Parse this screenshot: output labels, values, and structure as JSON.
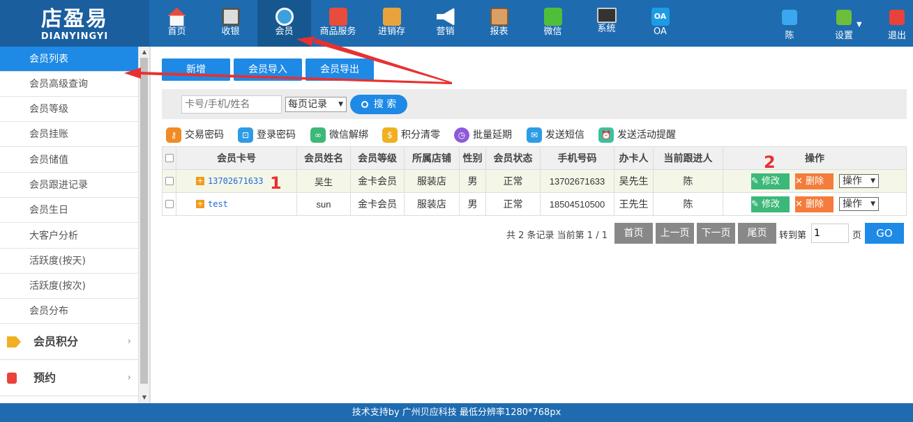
{
  "logo": {
    "big": "店盈易",
    "small": "DIANYINGYI"
  },
  "nav": [
    {
      "label": "首页",
      "icon": "home-icon"
    },
    {
      "label": "收银",
      "icon": "cash-register-icon"
    },
    {
      "label": "会员",
      "icon": "member-icon"
    },
    {
      "label": "商品服务",
      "icon": "product-icon"
    },
    {
      "label": "进销存",
      "icon": "inventory-icon"
    },
    {
      "label": "营销",
      "icon": "marketing-icon"
    },
    {
      "label": "报表",
      "icon": "report-icon"
    },
    {
      "label": "微信",
      "icon": "wechat-icon"
    },
    {
      "label": "系统",
      "icon": "system-icon"
    },
    {
      "label": "OA",
      "icon": "oa-icon"
    }
  ],
  "nav_right": {
    "user": "陈",
    "settings": "设置",
    "logout": "退出",
    "oa_badge": "OA"
  },
  "sidebar": {
    "items": [
      "会员列表",
      "会员高级查询",
      "会员等级",
      "会员挂账",
      "会员储值",
      "会员跟进记录",
      "会员生日",
      "大客户分析",
      "活跃度(按天)",
      "活跃度(按次)",
      "会员分布"
    ],
    "groups": [
      {
        "label": "会员积分",
        "icon": "tag-icon"
      },
      {
        "label": "预约",
        "icon": "phone-icon"
      }
    ],
    "chevron": "›"
  },
  "toolbar": {
    "add": "新增",
    "import": "会员导入",
    "export": "会员导出"
  },
  "search": {
    "placeholder": "卡号/手机/姓名",
    "per_page": "每页记录",
    "button": "搜 索"
  },
  "actions": [
    "交易密码",
    "登录密码",
    "微信解绑",
    "积分清零",
    "批量延期",
    "发送短信",
    "发送活动提醒"
  ],
  "table": {
    "columns": [
      "会员卡号",
      "会员姓名",
      "会员等级",
      "所属店铺",
      "性别",
      "会员状态",
      "手机号码",
      "办卡人",
      "当前跟进人",
      "操作"
    ],
    "rows": [
      {
        "card": "13702671633",
        "name": "吴生",
        "level": "金卡会员",
        "store": "服装店",
        "gender": "男",
        "status": "正常",
        "phone": "13702671633",
        "issuer": "吴先生",
        "follower": "陈"
      },
      {
        "card": "test",
        "name": "sun",
        "level": "金卡会员",
        "store": "服装店",
        "gender": "男",
        "status": "正常",
        "phone": "18504510500",
        "issuer": "王先生",
        "follower": "陈"
      }
    ],
    "edit": "修改",
    "delete": "删除",
    "op": "操作",
    "plus": "+"
  },
  "pager": {
    "info": "共 2 条记录 当前第 1 / 1",
    "first": "首页",
    "prev": "上一页",
    "next": "下一页",
    "last": "尾页",
    "goto": "转到第",
    "page_value": "1",
    "page_unit": "页",
    "go": "GO"
  },
  "annotations": {
    "one": "1",
    "two": "2"
  },
  "footer": "技术支持by 广州贝应科技    最低分辨率1280*768px",
  "colors": {
    "header": "#1e6bb0",
    "accent": "#1e8ae6",
    "edit": "#3cb878",
    "delete": "#f47c3c",
    "annotation": "#e83030"
  }
}
